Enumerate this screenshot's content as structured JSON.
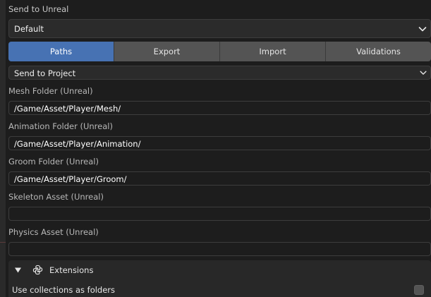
{
  "header": {
    "title": "Send to Unreal"
  },
  "preset": {
    "value": "Default",
    "icon": "chevron-down-icon"
  },
  "tabs": [
    {
      "label": "Paths",
      "active": true
    },
    {
      "label": "Export",
      "active": false
    },
    {
      "label": "Import",
      "active": false
    },
    {
      "label": "Validations",
      "active": false
    }
  ],
  "send_mode": {
    "value": "Send to Project",
    "icon": "chevron-down-icon"
  },
  "fields": {
    "mesh": {
      "label": "Mesh Folder (Unreal)",
      "value": "/Game/Asset/Player/Mesh/"
    },
    "animation": {
      "label": "Animation Folder (Unreal)",
      "value": "/Game/Asset/Player/Animation/"
    },
    "groom": {
      "label": "Groom Folder (Unreal)",
      "value": "/Game/Asset/Player/Groom/"
    },
    "skeleton": {
      "label": "Skeleton Asset (Unreal)",
      "value": ""
    },
    "physics": {
      "label": "Physics Asset (Unreal)",
      "value": ""
    }
  },
  "extensions": {
    "title": "Extensions",
    "expanded": true,
    "toggle_icon": "triangle-down-icon",
    "icon": "python-icon",
    "options": [
      {
        "label": "Use collections as folders",
        "checked": false
      }
    ]
  },
  "colors": {
    "accent": "#4772b3",
    "panel_bg": "#1d1d1d",
    "tab_bg": "#545454"
  }
}
